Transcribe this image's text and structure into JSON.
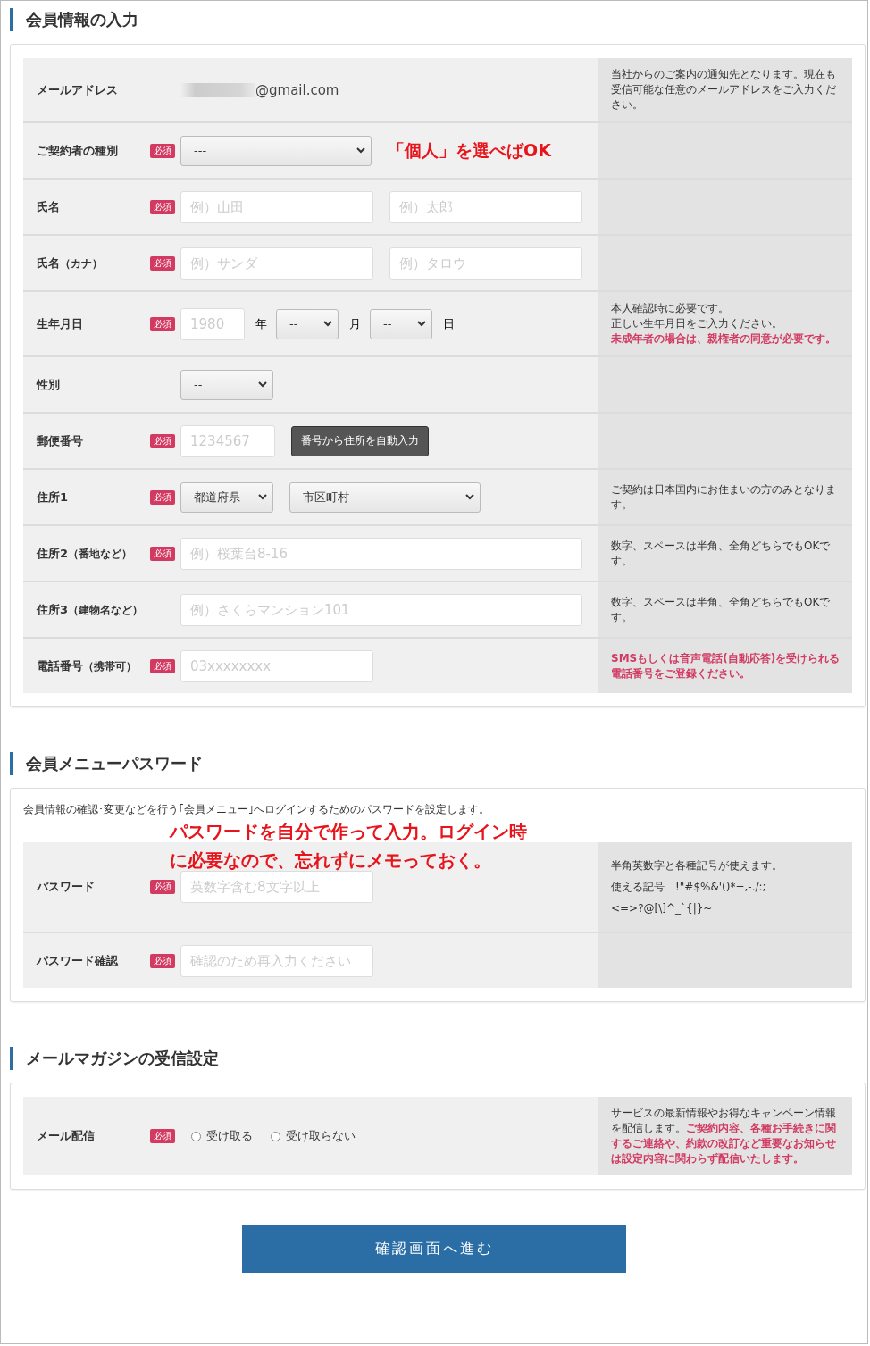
{
  "sections": [
    {
      "title": "会員情報の入力",
      "rows": [
        {
          "label": "メールアドレス",
          "sublabel": "",
          "controls": [
            {
              "kind": "masked-text",
              "value": "@gmail.com"
            }
          ],
          "note": [
            [
              {
                "text": "当社からのご案内の通知先となります。現在も受信可能な任意のメールアドレスをご入力ください。",
                "highlight": false
              }
            ]
          ]
        },
        {
          "label": "ご契約者の種別",
          "sublabel": "",
          "badge": "必須",
          "controls": [
            {
              "kind": "select-wide",
              "value": "---"
            },
            {
              "kind": "annotation",
              "value": "「個人」を選べばOK"
            }
          ],
          "note": []
        },
        {
          "label": "氏名",
          "sublabel": "",
          "badge": "必須",
          "controls": [
            {
              "kind": "input",
              "placeholder": "例）山田"
            },
            {
              "kind": "input",
              "placeholder": "例）太郎"
            }
          ],
          "note": []
        },
        {
          "label": "氏名",
          "sublabel": "（カナ）",
          "badge": "必須",
          "controls": [
            {
              "kind": "input",
              "placeholder": "例）サンダ"
            },
            {
              "kind": "input",
              "placeholder": "例）タロウ"
            }
          ],
          "note": []
        },
        {
          "label": "生年月日",
          "sublabel": "",
          "badge": "必須",
          "controls": [
            {
              "kind": "input-short",
              "placeholder": "1980"
            },
            {
              "kind": "unit",
              "value": "年"
            },
            {
              "kind": "select-short",
              "value": "--"
            },
            {
              "kind": "unit",
              "value": "月"
            },
            {
              "kind": "select-short",
              "value": "--"
            },
            {
              "kind": "unit",
              "value": "日"
            }
          ],
          "note": [
            [
              {
                "text": "本人確認時に必要です。",
                "highlight": false
              }
            ],
            [
              {
                "text": "正しい生年月日をご入力ください。",
                "highlight": false
              }
            ],
            [
              {
                "text": "未成年者の場合は、親権者の同意が必要です。",
                "highlight": true
              }
            ]
          ]
        },
        {
          "label": "性別",
          "sublabel": "",
          "controls": [
            {
              "kind": "select",
              "value": "--"
            }
          ],
          "note": []
        },
        {
          "label": "郵便番号",
          "sublabel": "",
          "badge": "必須",
          "controls": [
            {
              "kind": "input-zip",
              "placeholder": "1234567"
            },
            {
              "kind": "button",
              "value": "番号から住所を自動入力"
            }
          ],
          "note": []
        },
        {
          "label": "住所1",
          "sublabel": "",
          "badge": "必須",
          "controls": [
            {
              "kind": "select",
              "value": "都道府県"
            },
            {
              "kind": "select-wide",
              "value": "市区町村"
            }
          ],
          "note": [
            [
              {
                "text": "ご契約は日本国内にお住まいの方のみとなります。",
                "highlight": false
              }
            ]
          ]
        },
        {
          "label": "住所2",
          "sublabel": "（番地など）",
          "badge": "必須",
          "controls": [
            {
              "kind": "input-long",
              "placeholder": "例）桜葉台8-16"
            }
          ],
          "note": [
            [
              {
                "text": "数字、スペースは半角、全角どちらでもOKです。",
                "highlight": false
              }
            ]
          ]
        },
        {
          "label": "住所3",
          "sublabel": "（建物名など）",
          "controls": [
            {
              "kind": "input-long",
              "placeholder": "例）さくらマンション101"
            }
          ],
          "note": [
            [
              {
                "text": "数字、スペースは半角、全角どちらでもOKです。",
                "highlight": false
              }
            ]
          ]
        },
        {
          "label": "電話番号",
          "sublabel": "（携帯可）",
          "badge": "必須",
          "controls": [
            {
              "kind": "input",
              "placeholder": "03xxxxxxxx"
            }
          ],
          "note": [
            [
              {
                "text": "SMSもしくは音声電話(自動応答)を受けられる電話番号をご登録ください。",
                "highlight": true
              }
            ]
          ]
        }
      ]
    },
    {
      "title": "会員メニューパスワード",
      "intro": "会員情報の確認･変更などを行う｢会員メニュー｣へログインするためのパスワードを設定します。",
      "annotation": "パスワードを自分で作って入力。ログイン時に必要なので、忘れずにメモっておく。",
      "rows": [
        {
          "label": "パスワード",
          "sublabel": "",
          "badge": "必須",
          "controls": [
            {
              "kind": "input",
              "placeholder": "英数字含む8文字以上"
            }
          ],
          "note": [
            [
              {
                "text": "半角英数字と各種記号が使えます。",
                "highlight": false
              }
            ],
            [
              {
                "text": "使える記号　!\"#$%&'()*+,-./:;",
                "highlight": false
              }
            ],
            [
              {
                "text": "<=>?@[\\]^_`{|}~",
                "highlight": false
              }
            ]
          ]
        },
        {
          "label": "パスワード確認",
          "sublabel": "",
          "badge": "必須",
          "controls": [
            {
              "kind": "input",
              "placeholder": "確認のため再入力ください"
            }
          ],
          "note": []
        }
      ]
    },
    {
      "title": "メールマガジンの受信設定",
      "rows": [
        {
          "label": "メール配信",
          "sublabel": "",
          "badge": "必須",
          "controls": [
            {
              "kind": "radio",
              "value": "受け取る",
              "checked": false
            },
            {
              "kind": "radio",
              "value": "受け取らない",
              "checked": false
            }
          ],
          "note": [
            [
              {
                "text": "サービスの最新情報やお得なキャンペーン情報を配信します。",
                "highlight": false
              },
              {
                "text": "ご契約内容、各種お手続きに関するご連絡や、約款の改訂など重要なお知らせは設定内容に関わらず配信いたします。",
                "highlight": true
              }
            ]
          ]
        }
      ]
    }
  ],
  "submit": "確認画面へ進む"
}
